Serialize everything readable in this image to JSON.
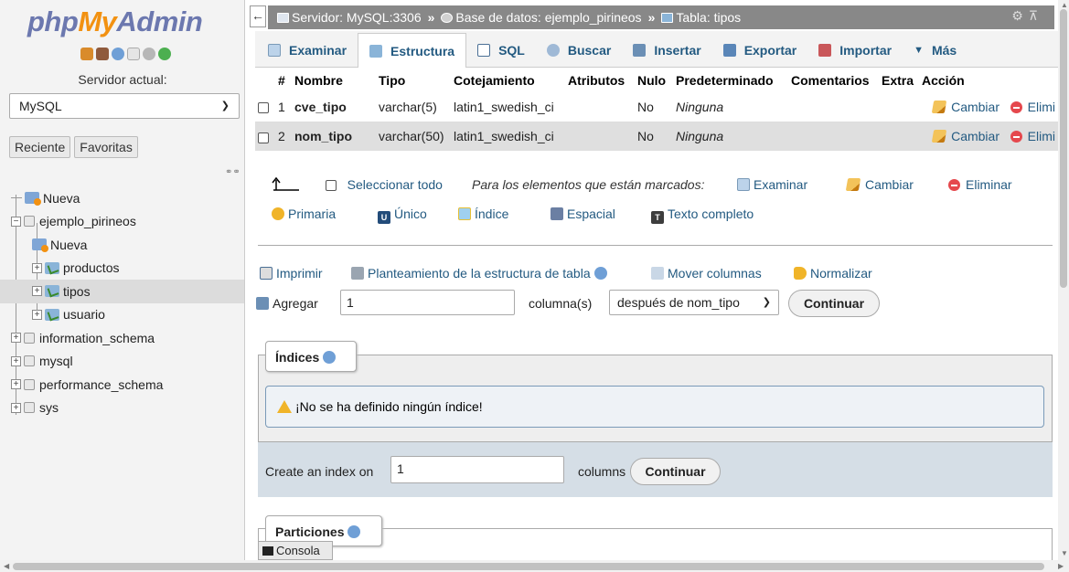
{
  "nav": {
    "logo": {
      "php": "php",
      "my": "My",
      "admin": "Admin"
    },
    "server_label": "Servidor actual:",
    "server_selected": "MySQL",
    "tab_recent": "Reciente",
    "tab_favorites": "Favoritas",
    "tree": {
      "new_root": "Nueva",
      "db_ejemplo": "ejemplo_pirineos",
      "new_in_db": "Nueva",
      "tbl_productos": "productos",
      "tbl_tipos": "tipos",
      "tbl_usuario": "usuario",
      "db_information": "information_schema",
      "db_mysql": "mysql",
      "db_performance": "performance_schema",
      "db_sys": "sys"
    }
  },
  "breadcrumb": {
    "server": "Servidor: MySQL:3306",
    "sep": "»",
    "database": "Base de datos: ejemplo_pirineos",
    "table": "Tabla: tipos"
  },
  "tabs": {
    "examinar": "Examinar",
    "estructura": "Estructura",
    "sql": "SQL",
    "buscar": "Buscar",
    "insertar": "Insertar",
    "exportar": "Exportar",
    "importar": "Importar",
    "mas": "Más"
  },
  "columns_table": {
    "headers": {
      "num": "#",
      "name": "Nombre",
      "type": "Tipo",
      "collation": "Cotejamiento",
      "attributes": "Atributos",
      "null": "Nulo",
      "default": "Predeterminado",
      "comments": "Comentarios",
      "extra": "Extra",
      "action": "Acción"
    },
    "rows": [
      {
        "num": "1",
        "name": "cve_tipo",
        "type": "varchar(5)",
        "collation": "latin1_swedish_ci",
        "null": "No",
        "default": "Ninguna",
        "change": "Cambiar",
        "drop": "Elimi"
      },
      {
        "num": "2",
        "name": "nom_tipo",
        "type": "varchar(50)",
        "collation": "latin1_swedish_ci",
        "null": "No",
        "default": "Ninguna",
        "change": "Cambiar",
        "drop": "Elimi"
      }
    ]
  },
  "bulk": {
    "select_all": "Seleccionar todo",
    "with_marked": "Para los elementos que están marcados:",
    "examinar": "Examinar",
    "cambiar": "Cambiar",
    "eliminar": "Eliminar",
    "primaria": "Primaria",
    "unico": "Único",
    "indice": "Índice",
    "espacial": "Espacial",
    "texto_completo": "Texto completo"
  },
  "tools": {
    "imprimir": "Imprimir",
    "planteamiento": "Planteamiento de la estructura de tabla",
    "mover": "Mover columnas",
    "normalizar": "Normalizar"
  },
  "add_columns": {
    "label": "Agregar",
    "count": "1",
    "unit": "columna(s)",
    "position": "después de nom_tipo",
    "button": "Continuar"
  },
  "indices": {
    "legend": "Índices",
    "notice": "¡No se ha definido ningún índice!",
    "create_label": "Create an index on",
    "create_count": "1",
    "create_unit": "columns",
    "create_button": "Continuar"
  },
  "partitions": {
    "legend": "Particiones"
  },
  "console": {
    "label": "Consola"
  }
}
